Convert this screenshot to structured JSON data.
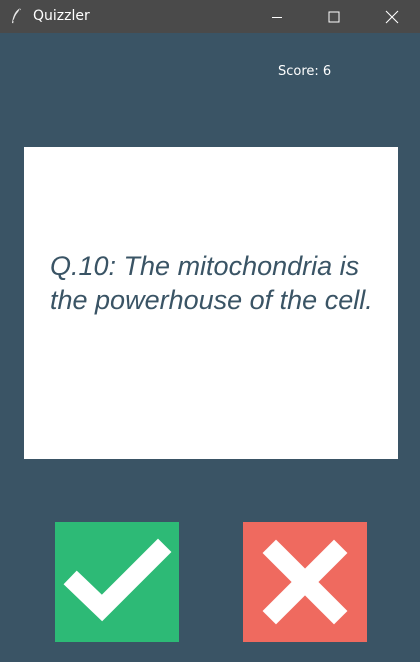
{
  "window": {
    "title": "Quizzler",
    "app_icon": "feather-icon",
    "controls": [
      "minimize-icon",
      "maximize-icon",
      "close-icon"
    ]
  },
  "score": {
    "label": "Score: 6"
  },
  "question": {
    "text": "Q.10: The mitochondria is the powerhouse of the cell."
  },
  "answers": {
    "true_button": {
      "icon": "checkmark-icon",
      "color": "#2dba76"
    },
    "false_button": {
      "icon": "cross-icon",
      "color": "#ef6a5f"
    }
  },
  "colors": {
    "background": "#3a5465",
    "titlebar": "#4a4a4a",
    "card": "#ffffff",
    "question_text": "#3a5465"
  }
}
